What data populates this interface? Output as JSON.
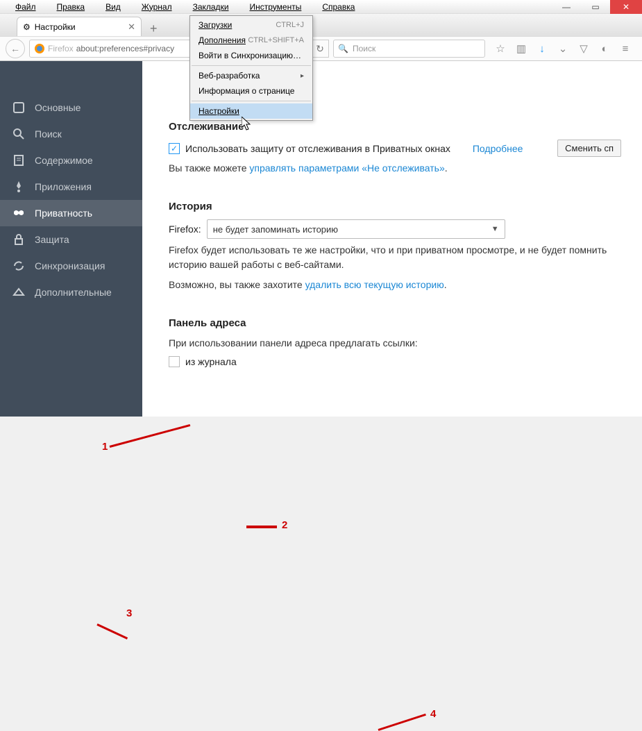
{
  "menubar": [
    "Файл",
    "Правка",
    "Вид",
    "Журнал",
    "Закладки",
    "Инструменты",
    "Справка"
  ],
  "tab": {
    "title": "Настройки"
  },
  "url": {
    "brand": "Firefox",
    "address": "about:preferences#privacy"
  },
  "search_placeholder": "Поиск",
  "dropdown": {
    "items": [
      {
        "label": "Загрузки",
        "shortcut": "CTRL+J"
      },
      {
        "label": "Дополнения",
        "shortcut": "CTRL+SHIFT+A"
      },
      {
        "label": "Войти в Синхронизацию…"
      },
      {
        "sep": true
      },
      {
        "label": "Веб-разработка",
        "submenu": true
      },
      {
        "label": "Информация о странице"
      },
      {
        "sep": true
      },
      {
        "label": "Настройки",
        "highlight": true
      }
    ]
  },
  "sidebar": {
    "items": [
      {
        "label": "Основные"
      },
      {
        "label": "Поиск"
      },
      {
        "label": "Содержимое"
      },
      {
        "label": "Приложения"
      },
      {
        "label": "Приватность",
        "active": true
      },
      {
        "label": "Защита"
      },
      {
        "label": "Синхронизация"
      },
      {
        "label": "Дополнительные"
      }
    ]
  },
  "main": {
    "tracking": {
      "title": "Отслеживание",
      "checkbox_label": "Использовать защиту от отслеживания в Приватных окнах",
      "more": "Подробнее",
      "button": "Сменить сп",
      "note_prefix": "Вы также можете ",
      "note_link": "управлять параметрами «Не отслеживать»",
      "note_suffix": "."
    },
    "history": {
      "title": "История",
      "label": "Firefox:",
      "select_value": "не будет запоминать историю",
      "para": "Firefox будет использовать те же настройки, что и при приватном просмотре, и не будет помнить историю вашей работы с веб-сайтами.",
      "suggest_prefix": "Возможно, вы также захотите ",
      "suggest_link": "удалить всю текущую историю",
      "suggest_suffix": "."
    },
    "addressbar": {
      "title": "Панель адреса",
      "desc": "При использовании панели адреса предлагать ссылки:",
      "opt1": "из журнала"
    }
  },
  "anno": {
    "n1": "1",
    "n2": "2",
    "n3": "3",
    "n4": "4"
  }
}
